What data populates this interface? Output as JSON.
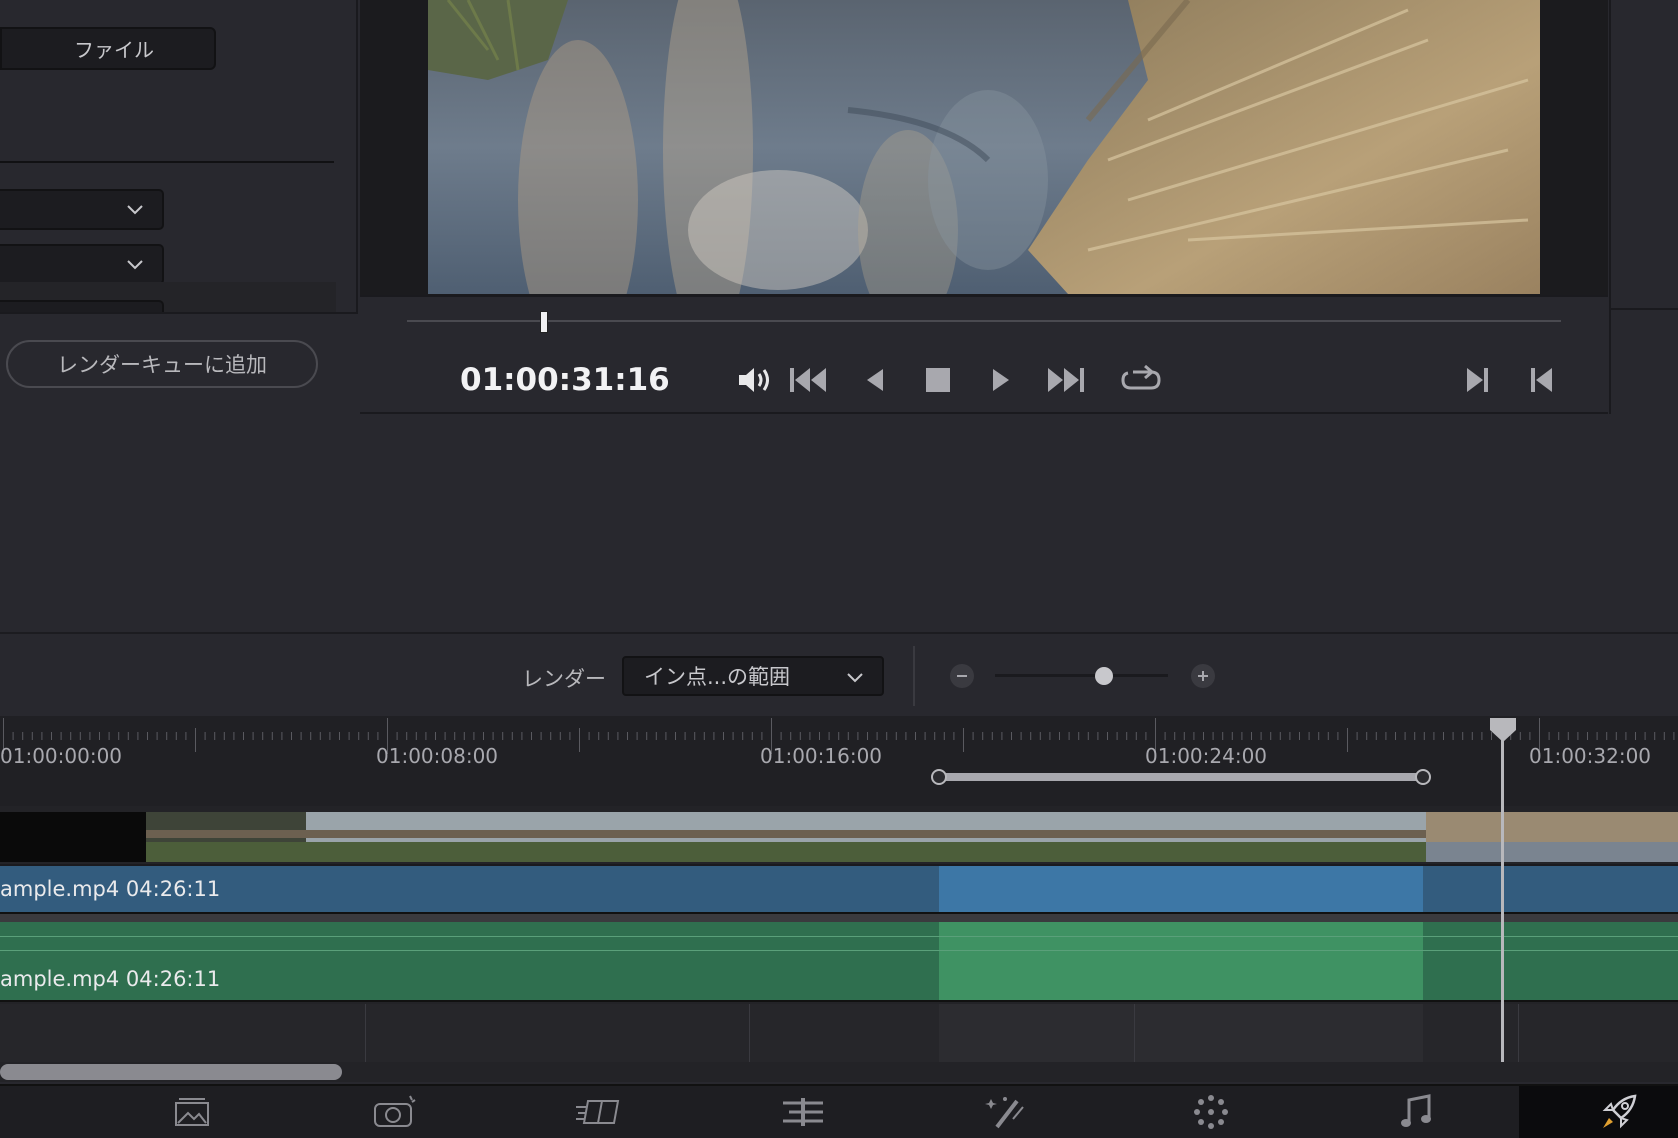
{
  "left_panel": {
    "file_tab_label": "ファイル",
    "add_to_render_queue_label": "レンダーキューに追加"
  },
  "viewer": {
    "timecode": "01:00:31:16",
    "scrub_position_fraction": 0.11
  },
  "transport": {
    "buttons": [
      "volume-icon",
      "jump-to-start-icon",
      "play-reverse-icon",
      "stop-icon",
      "play-icon",
      "jump-to-end-icon",
      "loop-icon",
      "next-edit-icon",
      "prev-edit-icon"
    ]
  },
  "timeline_toolbar": {
    "render_label": "レンダー",
    "render_range_value": "イン点...の範囲",
    "zoom_level_fraction": 0.6
  },
  "ruler": {
    "timecodes": [
      "01:00:00:00",
      "01:00:08:00",
      "01:00:16:00",
      "01:00:24:00",
      "01:00:32:00"
    ]
  },
  "tracks": {
    "video_clip_label": "ample.mp4  04:26:11",
    "audio_clip_label": "ample.mp4  04:26:11"
  },
  "page_nav": {
    "pages": [
      "media-page-icon",
      "cut-page-icon",
      "edit-page-icon",
      "fusion-page-icon",
      "color-page-icon",
      "fairlight-page-icon",
      "deliver-page-icon"
    ],
    "active": "deliver-page-icon"
  },
  "colors": {
    "video_clip": "#335c7e",
    "video_clip_selected": "#3d77a6",
    "audio_clip": "#2f6f4f",
    "audio_clip_selected": "#3f9263"
  }
}
